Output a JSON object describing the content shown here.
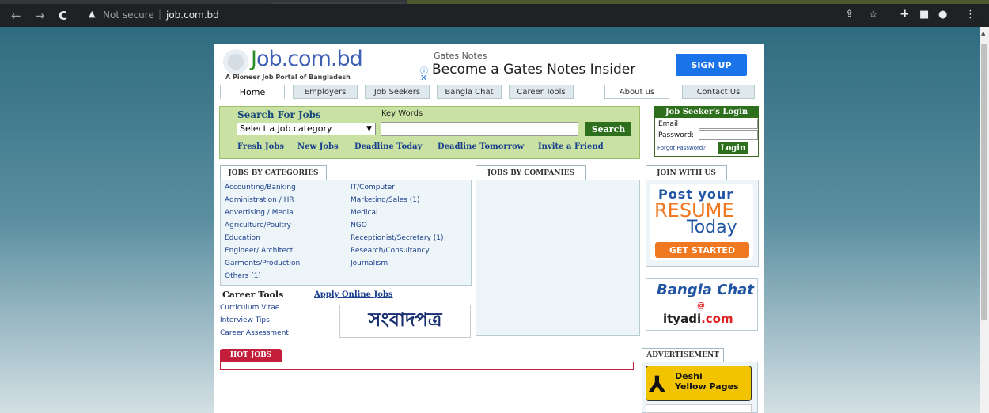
{
  "browser": {
    "not_secure": "Not secure",
    "url": "job.com.bd"
  },
  "site": {
    "logo_text_a": "J",
    "logo_text_b": "ob.com.bd",
    "logo_tagline": "A Pioneer Job Portal of Bangladesh"
  },
  "ad": {
    "source": "Gates Notes",
    "headline": "Become a Gates Notes Insider",
    "cta": "SIGN UP"
  },
  "menu": [
    "Home",
    "Employers",
    "Job Seekers",
    "Bangla Chat",
    "Career Tools",
    "About us",
    "Contact Us"
  ],
  "search": {
    "title": "Search For Jobs",
    "keywords_label": "Key Words",
    "category_selected": "Select a job category",
    "keyword_value": "",
    "button": "Search",
    "links": [
      "Fresh Jobs",
      "New Jobs",
      "Deadline Today",
      "Deadline Tomorrow",
      "Invite a Friend"
    ]
  },
  "login": {
    "title": "Job Seeker's Login",
    "email_label": "Email",
    "email_colon": ":",
    "password_label": "Password:",
    "forgot": "Forgot Password?",
    "button": "Login"
  },
  "categories": {
    "title": "JOBS BY CATEGORIES",
    "left": [
      "Accounting/Banking",
      "Administration / HR",
      "Advertising / Media",
      "Agriculture/Poultry",
      "Education",
      "Engineer/ Architect",
      "Garments/Production",
      "Others (1)"
    ],
    "right": [
      "IT/Computer",
      "Marketing/Sales (1)",
      "Medical",
      "NGO",
      "Receptionist/Secretary (1)",
      "Research/Consultancy",
      "Journalism"
    ]
  },
  "companies": {
    "title": "JOBS BY COMPANIES"
  },
  "join": {
    "title": "JOIN WITH US",
    "post": "Post your",
    "resume": "RESUME",
    "today": "Today",
    "cta": "GET STARTED"
  },
  "bangla_chat": {
    "title": "Bangla Chat",
    "at": "@",
    "domain_a": "ityadi",
    "domain_b": ".com"
  },
  "career": {
    "title": "Career Tools",
    "apply": "Apply Online Jobs",
    "items": [
      "Curriculum Vitae",
      "Interview Tips",
      "Career Assessment"
    ],
    "sambad": "সংবাদপত্র"
  },
  "hot_jobs": {
    "title": "HOT JOBS"
  },
  "advertisement": {
    "title": "ADVERTISEMENT",
    "yellow_line1": "Deshi",
    "yellow_line2": "Yellow Pages"
  }
}
